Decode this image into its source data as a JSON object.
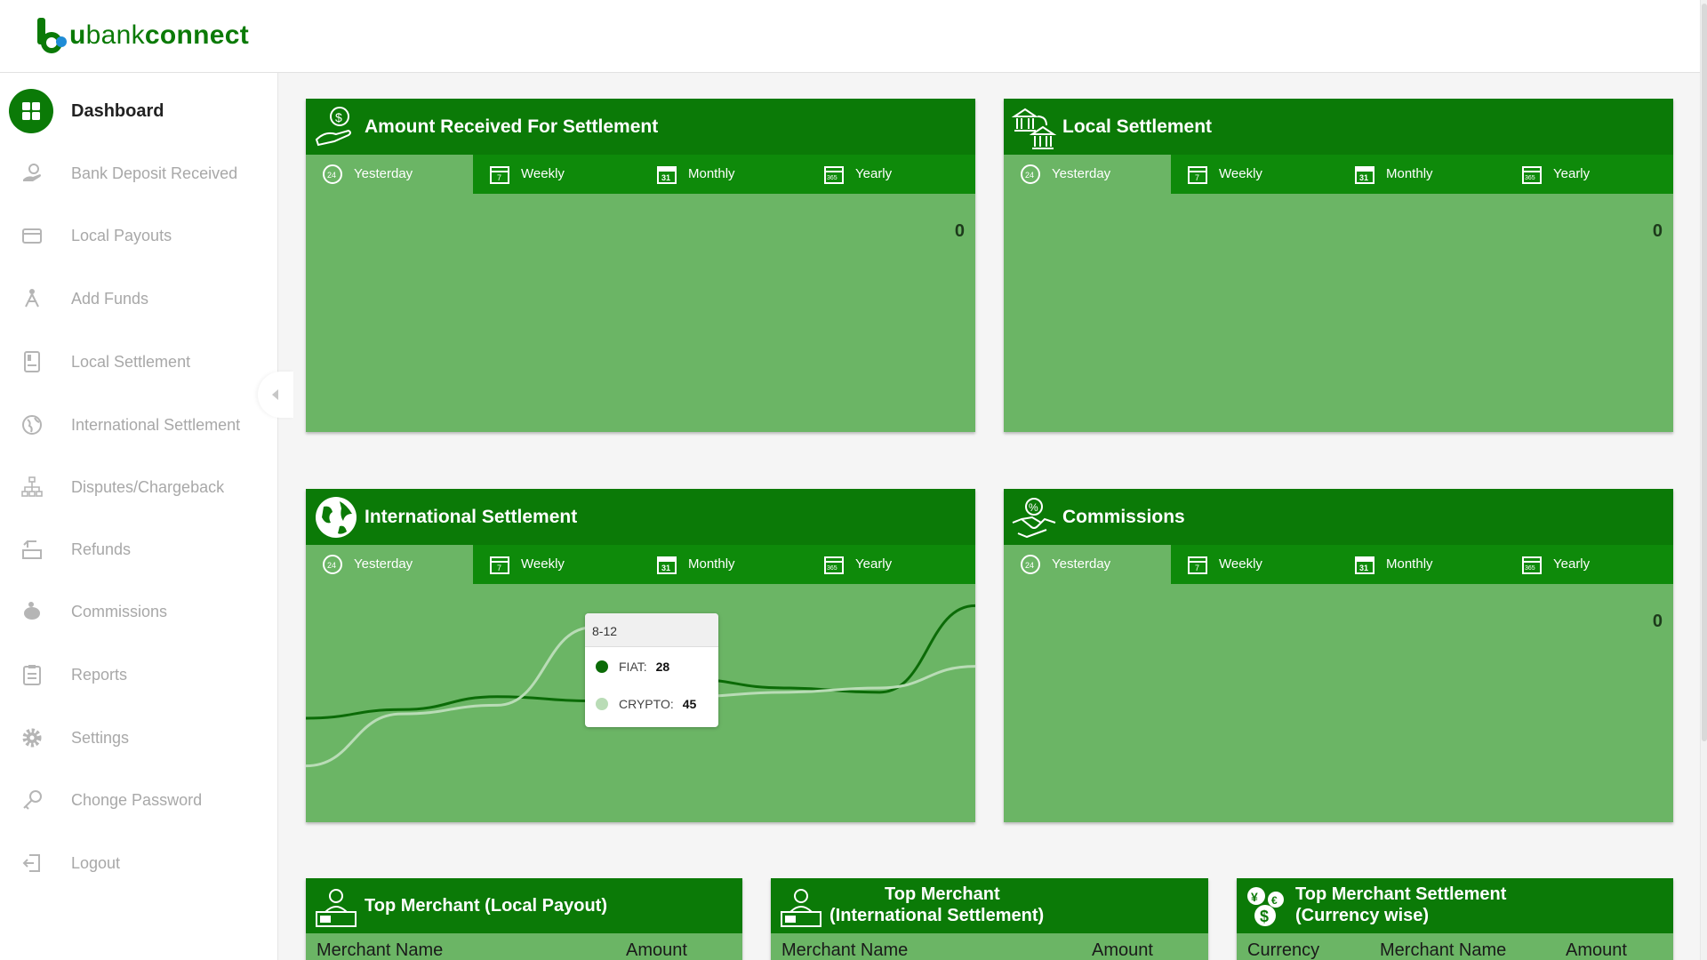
{
  "brand": {
    "u": "u",
    "bank": "bank",
    "connect": "connect"
  },
  "sidebar": {
    "items": [
      {
        "label": "Dashboard",
        "icon": "dashboard-grid-icon"
      },
      {
        "label": "Bank Deposit Received",
        "icon": "deposit-hand-icon"
      },
      {
        "label": "Local Payouts",
        "icon": "wallet-icon"
      },
      {
        "label": "Add Funds",
        "icon": "funds-tree-icon"
      },
      {
        "label": "Local Settlement",
        "icon": "ledger-icon"
      },
      {
        "label": "International Settlement",
        "icon": "globe-icon"
      },
      {
        "label": "Disputes/Chargeback",
        "icon": "hierarchy-icon"
      },
      {
        "label": "Refunds",
        "icon": "refund-icon"
      },
      {
        "label": "Commissions",
        "icon": "piggy-bank-icon"
      },
      {
        "label": "Reports",
        "icon": "clipboard-icon"
      },
      {
        "label": "Settings",
        "icon": "gear-icon"
      },
      {
        "label": "Chonge Password",
        "icon": "key-icon"
      },
      {
        "label": "Logout",
        "icon": "logout-icon"
      }
    ]
  },
  "tabs": [
    "Yesterday",
    "Weekly",
    "Monthly",
    "Yearly"
  ],
  "cards": {
    "received": {
      "title": "Amount Received For Settlement",
      "value": "0"
    },
    "local": {
      "title": "Local Settlement",
      "value": "0"
    },
    "international": {
      "title": "International Settlement"
    },
    "commissions": {
      "title": "Commissions",
      "value": "0"
    }
  },
  "chart_data": {
    "type": "line",
    "series": [
      {
        "name": "FIAT",
        "color": "#0b6b07",
        "values": [
          24,
          26,
          29,
          28,
          33,
          31,
          30,
          50
        ]
      },
      {
        "name": "CRYPTO",
        "color": "#b9dcb6",
        "values": [
          13,
          25,
          27,
          45,
          29,
          30,
          31,
          36
        ]
      }
    ],
    "tooltip": {
      "label": "8-12",
      "fiat_label": "FIAT:",
      "fiat_value": "28",
      "crypto_label": "CRYPTO:",
      "crypto_value": "45"
    }
  },
  "tables": {
    "local_payout": {
      "title": "Top Merchant (Local Payout)",
      "col1": "Merchant Name",
      "col2": "Amount"
    },
    "international": {
      "title_line1": "Top Merchant",
      "title_line2": "(International Settlement)",
      "col1": "Merchant Name",
      "col2": "Amount"
    },
    "currency": {
      "title_line1": "Top Merchant Settlement",
      "title_line2": "(Currency wise)",
      "col1": "Currency",
      "col2": "Merchant Name",
      "col3": "Amount"
    }
  },
  "colors": {
    "brand_dark": "#0b7a07",
    "card_body": "#6bb565",
    "tab_bar": "#0e8a0a"
  }
}
